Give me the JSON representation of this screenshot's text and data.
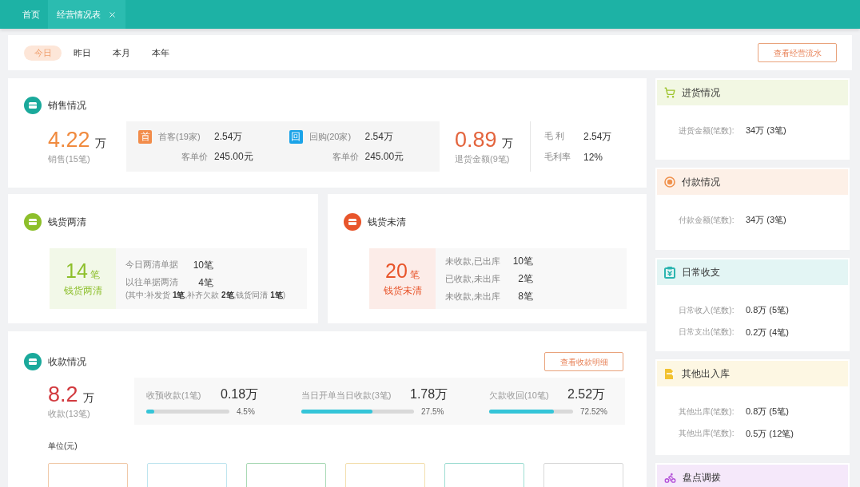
{
  "tabs": [
    {
      "label": "首页",
      "selected": false,
      "closable": false
    },
    {
      "label": "经营情况表",
      "selected": true,
      "closable": true
    }
  ],
  "periods": [
    {
      "label": "今日",
      "selected": true
    },
    {
      "label": "昨日",
      "selected": false
    },
    {
      "label": "本月",
      "selected": false
    },
    {
      "label": "本年",
      "selected": false
    }
  ],
  "flow_button": "查看经营流水",
  "sales": {
    "title": "销售情况",
    "color": "#1aa99b",
    "total": {
      "value": "4.22",
      "unit": "万",
      "caption": "销售(15笔)"
    },
    "groups": [
      {
        "badge": "首",
        "color": "#f28c4a",
        "label": "首客(19家)",
        "value": "2.54万",
        "price_label": "客单价",
        "price": "245.00元"
      },
      {
        "badge": "回",
        "color": "#1aa3e8",
        "label": "回购(20家)",
        "value": "2.54万",
        "price_label": "客单价",
        "price": "245.00元"
      }
    ],
    "returns": {
      "value": "0.89",
      "unit": "万",
      "caption": "退货金额(9笔)"
    },
    "profit": [
      {
        "label": "毛 利",
        "value": "2.54万"
      },
      {
        "label": "毛利率",
        "value": "12%"
      }
    ]
  },
  "reconciliation": [
    {
      "title": "钱货两清",
      "color": "#8dbf2b",
      "count": "14",
      "unit": "笔",
      "caption": "钱货两清",
      "rows": [
        {
          "label": "今日两清单据",
          "value": "10笔"
        },
        {
          "label": "以往单据两清",
          "value": "4笔",
          "note": "(其中:补发货 **1笔**,补齐欠款 **2笔**,钱货同清 **1笔**)"
        }
      ]
    },
    {
      "title": "钱货未清",
      "color": "#e8552b",
      "count": "20",
      "unit": "笔",
      "caption": "钱货未清",
      "rows": [
        {
          "label": "未收款,已出库",
          "value": "10笔"
        },
        {
          "label": "已收款,未出库",
          "value": "2笔"
        },
        {
          "label": "未收款,未出库",
          "value": "8笔"
        }
      ]
    }
  ],
  "receipts": {
    "title": "收款情况",
    "color": "#1aa99b",
    "button": "查看收款明细",
    "total": {
      "value": "8.2",
      "unit": "万",
      "caption": "收款(13笔)"
    },
    "items": [
      {
        "label": "收预收款(1笔)",
        "value": "0.18万",
        "level": 0.1,
        "percent": "4.5%"
      },
      {
        "label": "当日开单当日收款(3笔)",
        "value": "1.78万",
        "level": 0.63,
        "percent": "27.5%"
      },
      {
        "label": "欠款收回(10笔)",
        "value": "2.52万",
        "level": 0.77,
        "percent": "72.52%"
      }
    ],
    "unit_label": "单位(元)",
    "cards": [
      {
        "color": "#f0c9a9"
      },
      {
        "color": "#bfe5ef"
      },
      {
        "color": "#a9d9b5"
      },
      {
        "color": "#f3dfae"
      },
      {
        "color": "#9fddd3"
      },
      {
        "color": "#d9d9d9"
      }
    ]
  },
  "side_panels": [
    {
      "title": "进货情况",
      "kind": "cart",
      "color": "#9ec42c",
      "rows": [
        {
          "label": "进货金额(笔数):",
          "value": "34万 (3笔)"
        }
      ]
    },
    {
      "title": "付款情况",
      "kind": "coin",
      "color": "#f0924e",
      "rows": [
        {
          "label": "付款金额(笔数):",
          "value": "34万 (3笔)"
        }
      ]
    },
    {
      "title": "日常收支",
      "kind": "ledger",
      "color": "#2bb5b0",
      "rows": [
        {
          "label": "日常收入(笔数):",
          "value": "0.8万 (5笔)"
        },
        {
          "label": "日常支出(笔数):",
          "value": "0.2万 (4笔)"
        }
      ]
    },
    {
      "title": "其他出入库",
      "kind": "document",
      "color": "#f2c230",
      "rows": [
        {
          "label": "其他出库(笔数):",
          "value": "0.8万 (5笔)"
        },
        {
          "label": "其他出库(笔数):",
          "value": "0.5万 (12笔)"
        }
      ]
    },
    {
      "title": "盘点调拨",
      "kind": "bike",
      "color": "#b34fd8"
    }
  ]
}
